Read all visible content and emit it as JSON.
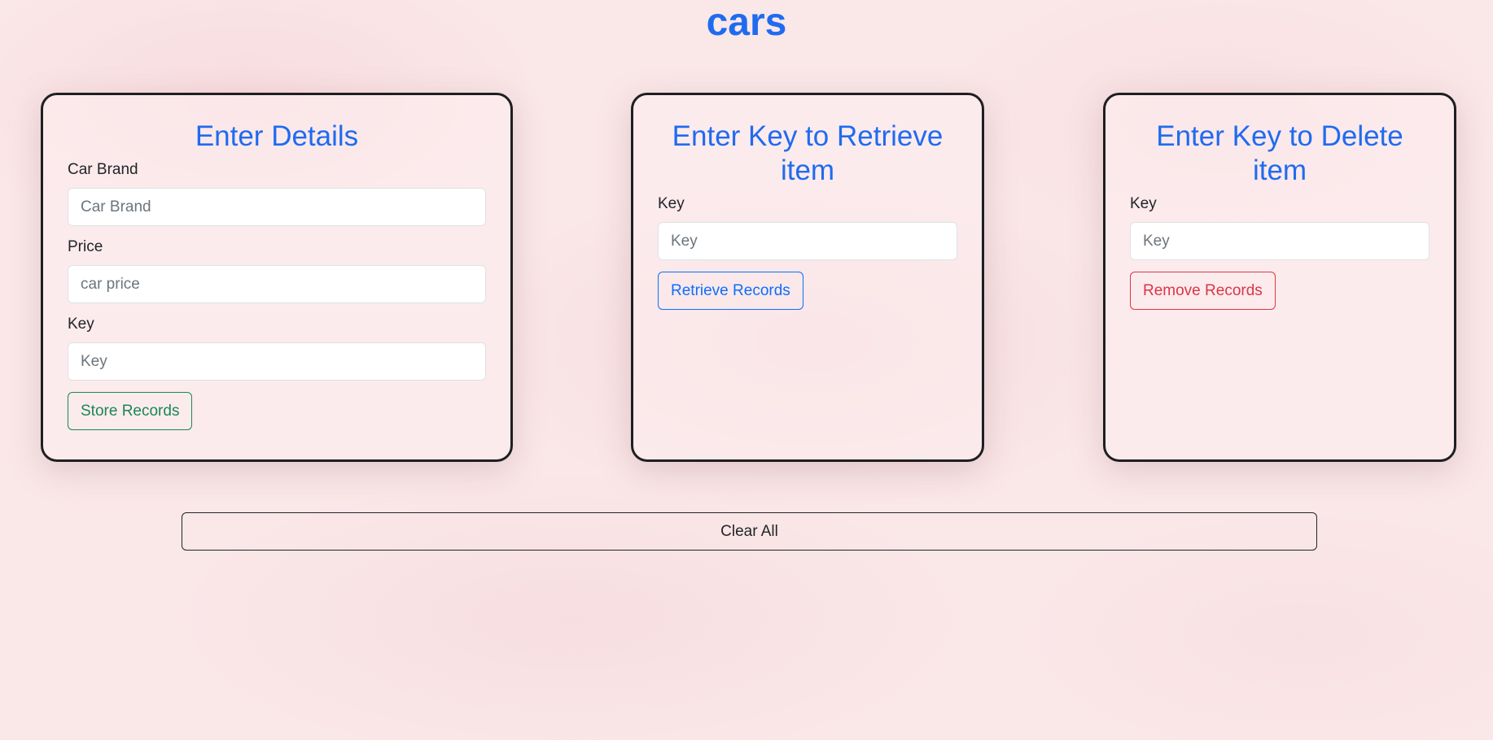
{
  "page": {
    "title": "cars"
  },
  "store_card": {
    "heading": "Enter Details",
    "brand_label": "Car Brand",
    "brand_placeholder": "Car Brand",
    "price_label": "Price",
    "price_placeholder": "car price",
    "key_label": "Key",
    "key_placeholder": "Key",
    "button_label": "Store Records"
  },
  "retrieve_card": {
    "heading": "Enter Key to Retrieve item",
    "key_label": "Key",
    "key_placeholder": "Key",
    "button_label": "Retrieve Records"
  },
  "delete_card": {
    "heading": "Enter Key to Delete item",
    "key_label": "Key",
    "key_placeholder": "Key",
    "button_label": "Remove Records"
  },
  "footer": {
    "clear_label": "Clear All"
  },
  "colors": {
    "heading": "#1f6bf0",
    "success": "#198754",
    "primary": "#0d6efd",
    "danger": "#dc3545",
    "background": "#fae7e8"
  }
}
